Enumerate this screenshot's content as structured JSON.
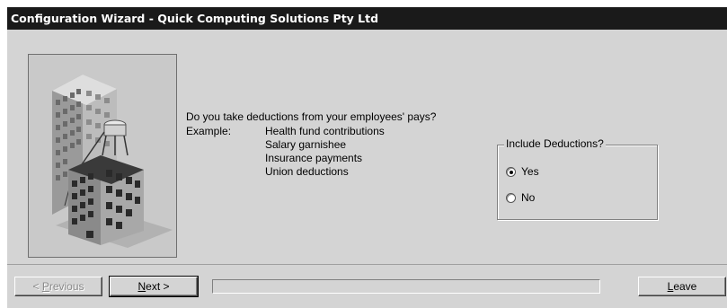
{
  "window": {
    "title": "Configuration Wizard - Quick Computing Solutions Pty Ltd"
  },
  "illustration": {
    "icon": "office-building-construction-illustration"
  },
  "main": {
    "question": "Do you take deductions from your employees' pays?",
    "example_label": "Example:",
    "examples": [
      "Health fund contributions",
      "Salary garnishee",
      "Insurance payments",
      "Union deductions"
    ]
  },
  "deductions_group": {
    "legend": "Include Deductions?",
    "options": [
      {
        "label": "Yes",
        "checked": true
      },
      {
        "label": "No",
        "checked": false
      }
    ]
  },
  "footer": {
    "previous_label": "Previous",
    "previous_label_rest": "revious",
    "previous_label_prefix": "< ",
    "previous_label_hotkey": "P",
    "next_label_hotkey": "N",
    "next_label_rest": "ext >",
    "leave_label_hotkey": "L",
    "leave_label_rest": "eave",
    "progress_fraction": 0
  },
  "colors": {
    "titlebar": "#1a1a1a",
    "dialog_face": "#d4d4d4"
  }
}
